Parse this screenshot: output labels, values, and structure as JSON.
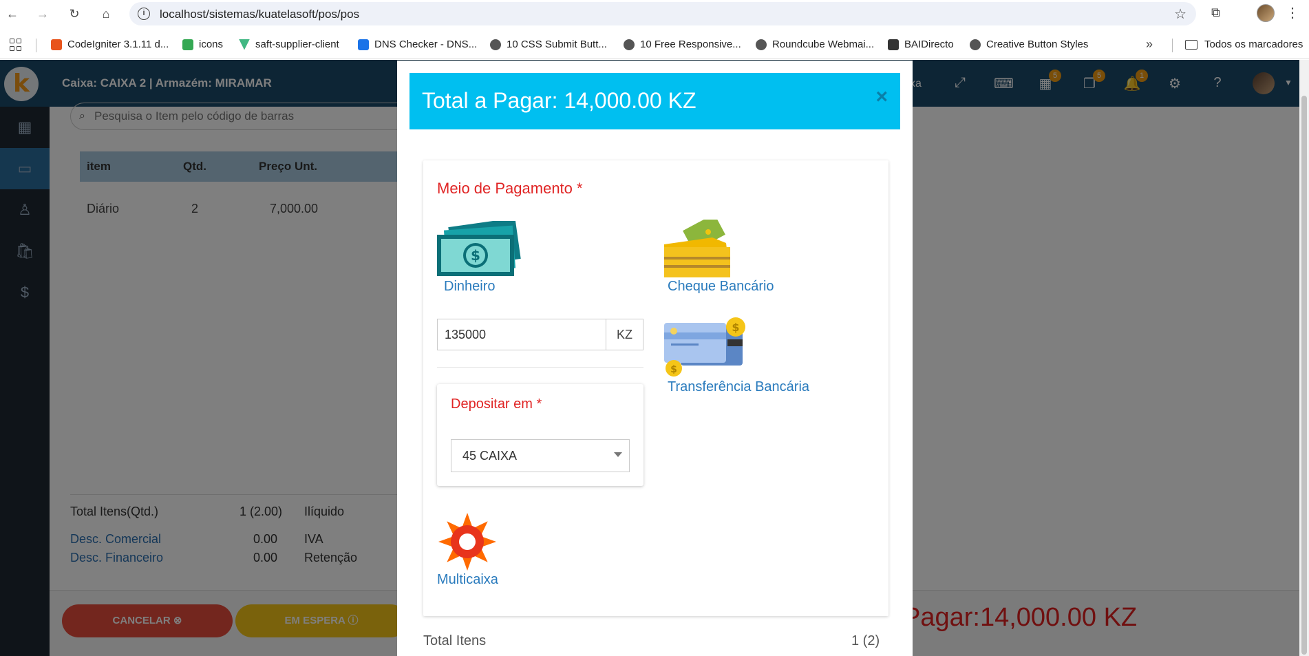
{
  "browser": {
    "url": "localhost/sistemas/kuatelasoft/pos/pos",
    "bookmarks": [
      {
        "label": "CodeIgniter 3.1.11 d...",
        "color": "#e8541b"
      },
      {
        "label": "icons",
        "color": "#34a853"
      },
      {
        "label": "saft-supplier-client",
        "color": "#41b883"
      },
      {
        "label": "DNS Checker - DNS...",
        "color": "#1a73e8"
      },
      {
        "label": "10 CSS Submit Butt...",
        "color": "#555555"
      },
      {
        "label": "10 Free Responsive...",
        "color": "#555555"
      },
      {
        "label": "Roundcube Webmai...",
        "color": "#555555"
      },
      {
        "label": "BAIDirecto",
        "color": "#333333"
      },
      {
        "label": "Creative Button Styles",
        "color": "#555555"
      }
    ],
    "all_bookmarks_label": "Todos os marcadores"
  },
  "app": {
    "logo_letter": "k",
    "header_title": "Caixa: CAIXA 2 | Armazém: MIRAMAR",
    "header_partial_text": "xa",
    "badges": {
      "calendar": "5",
      "book": "5",
      "bell": "1"
    },
    "search_placeholder": "Pesquisa o Item pelo código de barras",
    "table": {
      "headers": [
        "item",
        "Qtd.",
        "Preço Unt."
      ],
      "rows": [
        {
          "item": "Diário",
          "qty": "2",
          "price": "7,000.00"
        }
      ]
    },
    "totals": {
      "total_itens_label": "Total Itens(Qtd.)",
      "total_itens_value": "1 (2.00)",
      "iliquido_label": "Ilíquido",
      "desc_comercial_label": "Desc. Comercial",
      "desc_comercial_value": "0.00",
      "iva_label": "IVA",
      "desc_financeiro_label": "Desc. Financeiro",
      "desc_financeiro_value": "0.00",
      "retencao_label": "Retenção"
    },
    "buttons": {
      "cancel": "CANCELAR ⊗",
      "hold": "EM ESPERA ⓘ"
    },
    "pay_total_partial": "Pagar:14,000.00 KZ"
  },
  "modal": {
    "title": "Total a Pagar: 14,000.00 KZ",
    "close_symbol": "×",
    "payment_method_title": "Meio de Pagamento *",
    "methods": {
      "cash": "Dinheiro",
      "cheque": "Cheque Bancário",
      "transfer": "Transferência Bancária",
      "multicaixa": "Multicaixa"
    },
    "amount_value": "135000",
    "currency": "KZ",
    "deposit_title": "Depositar em *",
    "deposit_selected": "45 CAIXA",
    "footer_total_label": "Total Itens",
    "footer_total_value": "1 (2)"
  }
}
